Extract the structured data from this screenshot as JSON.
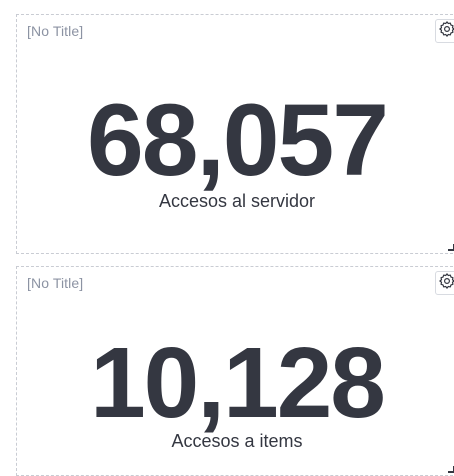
{
  "panels": [
    {
      "title": "[No Title]",
      "value": "68,057",
      "label": "Accesos al servidor",
      "options_icon": "gear-icon"
    },
    {
      "title": "[No Title]",
      "value": "10,128",
      "label": "Accesos a items",
      "options_icon": "gear-icon"
    }
  ],
  "colors": {
    "metric_text": "#343741",
    "title_text": "#8c93a3",
    "panel_border": "#c9ccd3"
  }
}
